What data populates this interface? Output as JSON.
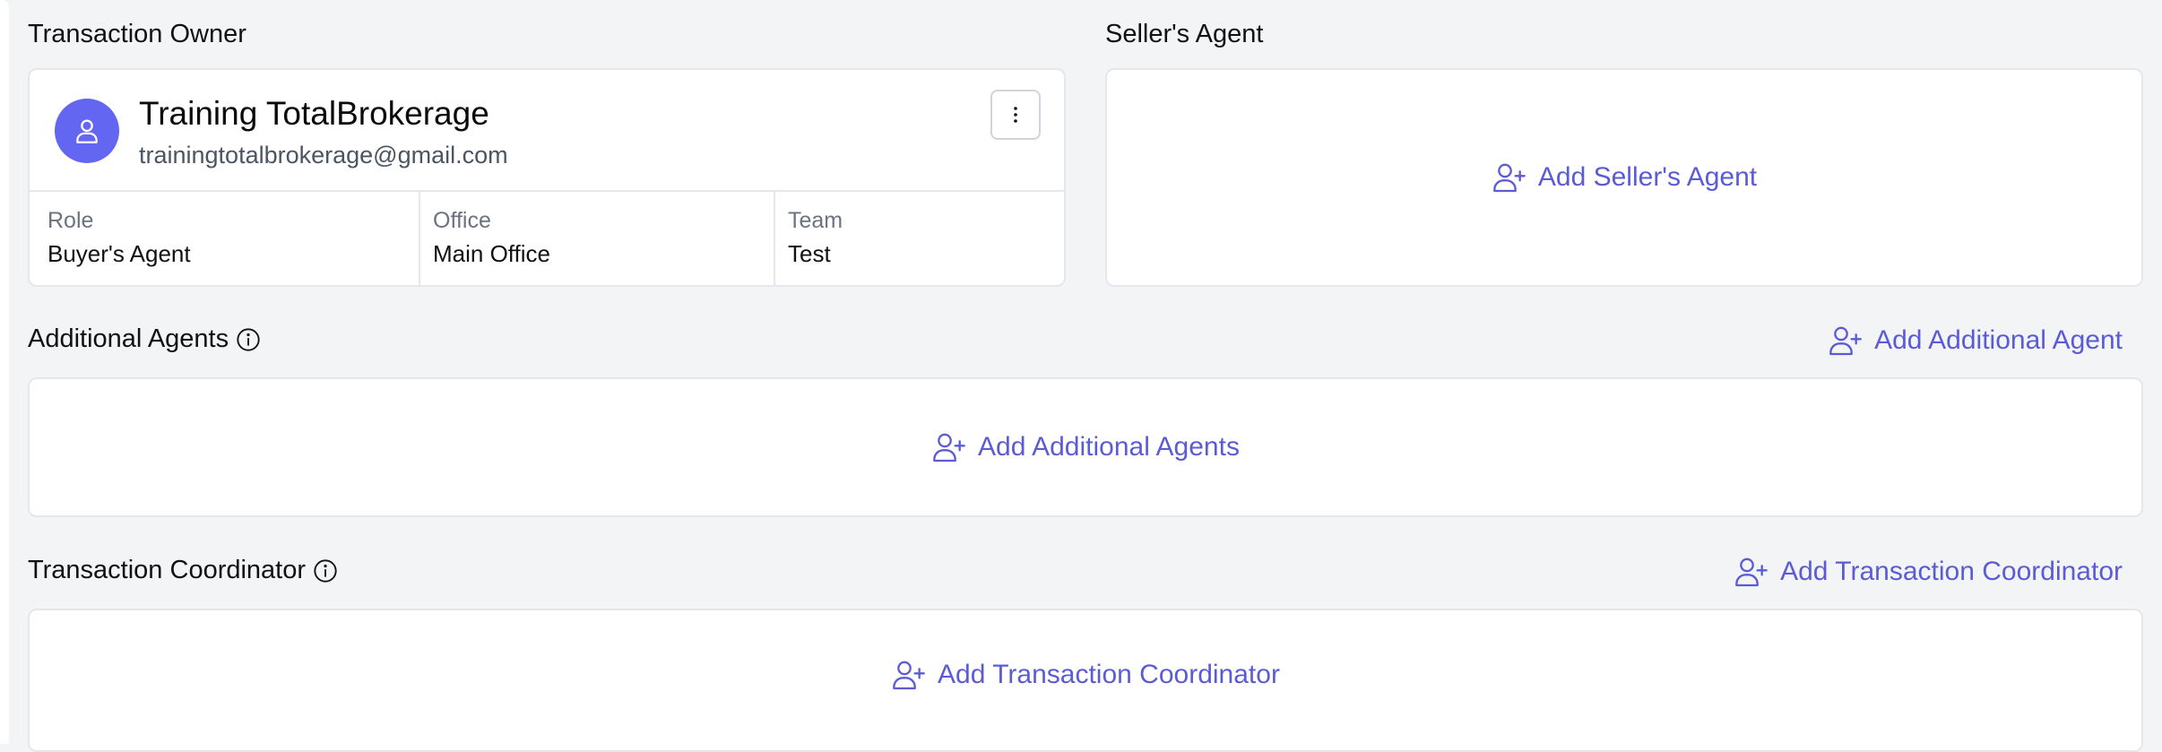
{
  "owner_section": {
    "title": "Transaction Owner",
    "name": "Training TotalBrokerage",
    "email": "trainingtotalbrokerage@gmail.com",
    "role_label": "Role",
    "role_value": "Buyer's Agent",
    "office_label": "Office",
    "office_value": "Main Office",
    "team_label": "Team",
    "team_value": "Test"
  },
  "sellers_agent": {
    "title": "Seller's Agent",
    "add_label": "Add Seller's Agent"
  },
  "additional_agents": {
    "title": "Additional Agents",
    "header_add_label": "Add Additional Agent",
    "body_add_label": "Add Additional Agents"
  },
  "transaction_coordinator": {
    "title": "Transaction Coordinator",
    "header_add_label": "Add Transaction Coordinator",
    "body_add_label": "Add Transaction Coordinator"
  },
  "colors": {
    "accent": "#5b5bd6",
    "avatar": "#6366f1",
    "background": "#f3f4f6",
    "card_border": "#e5e7eb"
  },
  "icons": {
    "avatar": "user-icon",
    "menu": "more-vertical-icon",
    "add": "user-plus-icon",
    "info": "info-circle-icon"
  }
}
